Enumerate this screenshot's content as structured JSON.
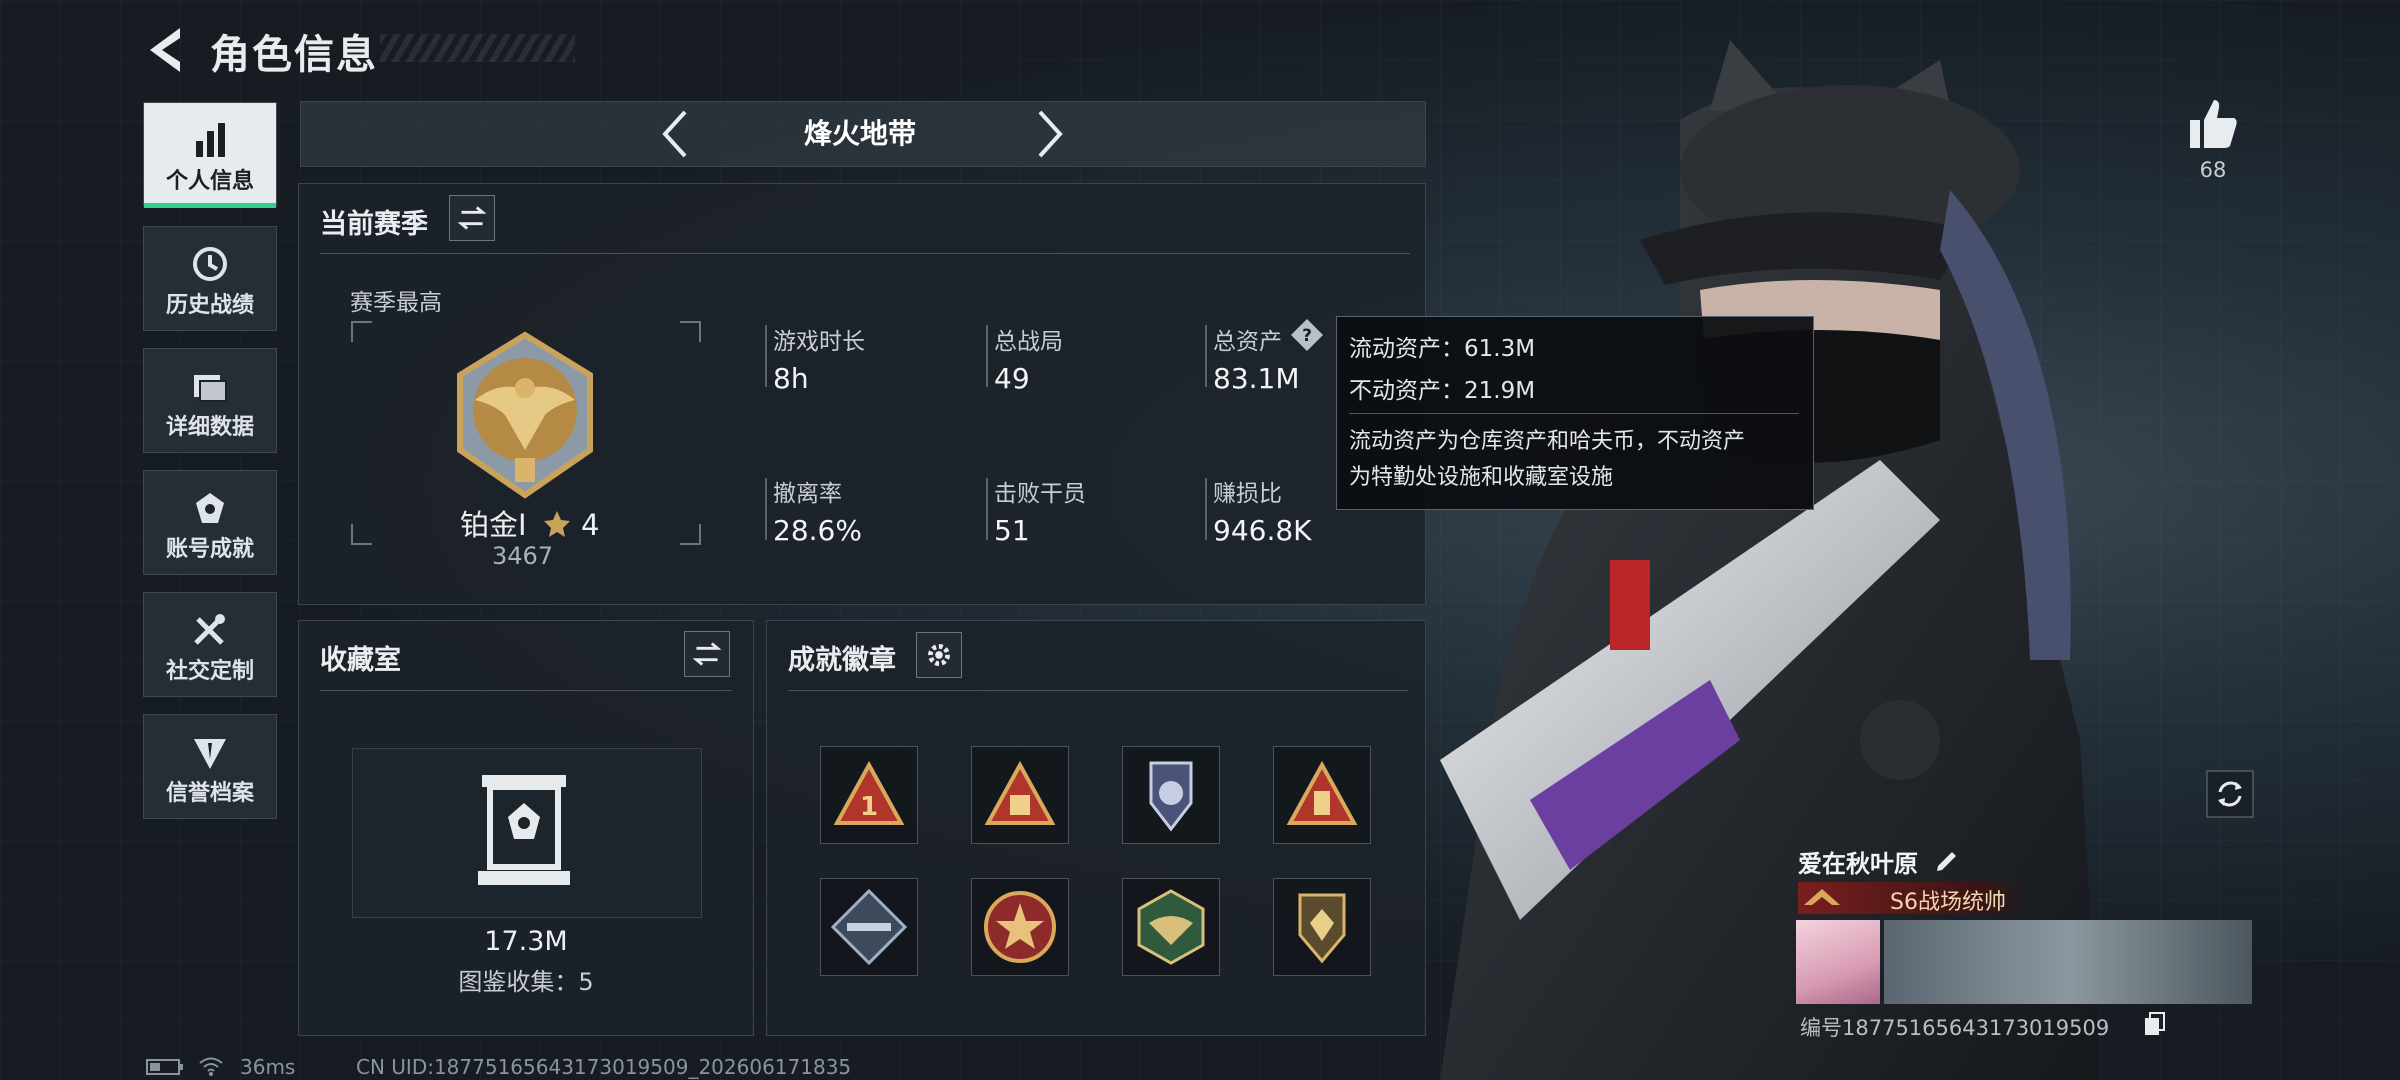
{
  "header": {
    "title": "角色信息"
  },
  "nav": [
    {
      "label": "个人信息",
      "icon": "bar-chart-icon",
      "active": true
    },
    {
      "label": "历史战绩",
      "icon": "history-icon"
    },
    {
      "label": "详细数据",
      "icon": "folder-icon"
    },
    {
      "label": "账号成就",
      "icon": "achievement-icon"
    },
    {
      "label": "社交定制",
      "icon": "tools-icon"
    },
    {
      "label": "信誉档案",
      "icon": "credit-icon"
    }
  ],
  "mode": {
    "label": "烽火地带"
  },
  "season": {
    "title": "当前赛季",
    "best_label": "赛季最高",
    "rank_name": "铂金Ⅰ",
    "rank_stars": "4",
    "rank_score": "3467",
    "stats": [
      {
        "label": "游戏时长",
        "value": "8h"
      },
      {
        "label": "总战局",
        "value": "49"
      },
      {
        "label": "总资产",
        "value": "83.1M"
      },
      {
        "label": "撤离率",
        "value": "28.6%"
      },
      {
        "label": "击败干员",
        "value": "51"
      },
      {
        "label": "赚损比",
        "value": "946.8K"
      }
    ]
  },
  "tooltip": {
    "liquid": "流动资产：61.3M",
    "fixed": "不动资产：21.9M",
    "desc1": "流动资产为仓库资产和哈夫币，不动资产",
    "desc2": "为特勤处设施和收藏室设施"
  },
  "collection": {
    "title": "收藏室",
    "value": "17.3M",
    "collected": "图鉴收集：5"
  },
  "badges": {
    "title": "成就徽章"
  },
  "profile": {
    "likes": "68",
    "name": "爱在秋叶原",
    "title_badge": "S6战场统帅",
    "id_text": "编号18775165643173019509"
  },
  "status": {
    "ping": "36ms",
    "uid": "CN UID:18775165643173019509_202606171835"
  },
  "colors": {
    "accent": "#2fd28a",
    "panel": "#1c2229",
    "rank_gold": "#c9a35b"
  }
}
